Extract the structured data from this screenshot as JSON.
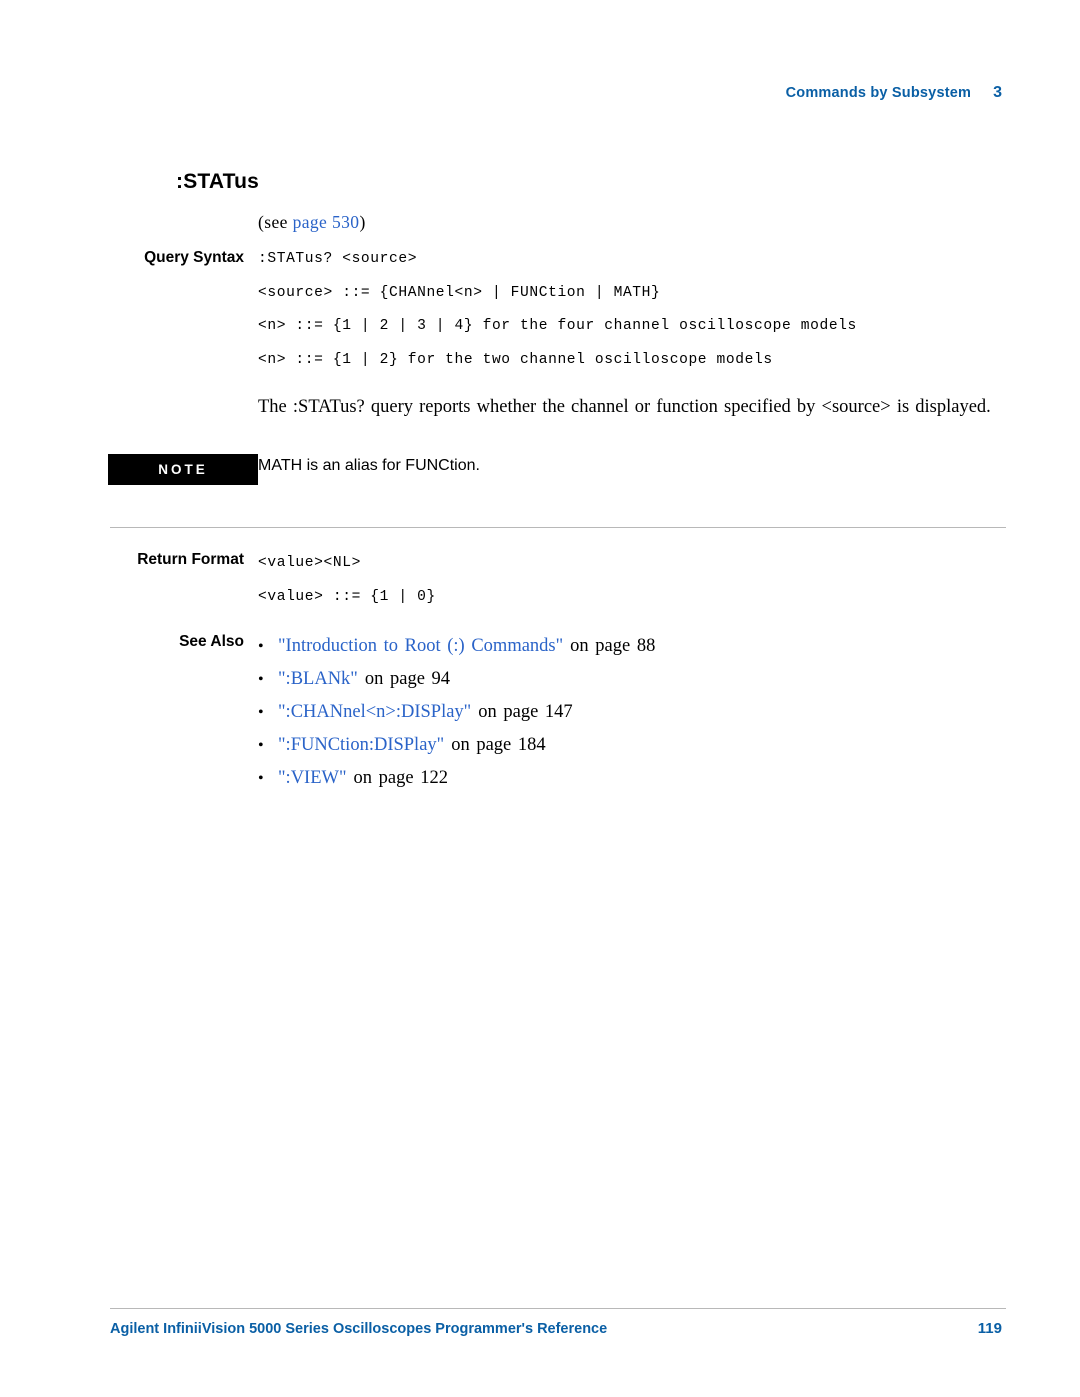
{
  "header": {
    "title": "Commands by Subsystem",
    "chapter": "3"
  },
  "command": {
    "title": ":STATus",
    "see_prefix": "(see ",
    "see_link": "page",
    "see_number": " 530",
    "see_suffix": ")"
  },
  "query_syntax": {
    "label": "Query Syntax",
    "lines": [
      ":STATus? <source>",
      "<source> ::= {CHANnel<n> | FUNCtion | MATH}",
      "<n> ::= {1 | 2 | 3 | 4} for the four channel oscilloscope models",
      "<n> ::= {1 | 2} for the two channel oscilloscope models"
    ]
  },
  "description": {
    "text": "The :STATus? query reports whether the channel or function specified by <source> is displayed."
  },
  "note": {
    "label": "NOTE",
    "text": "MATH is an alias for FUNCtion."
  },
  "return_format": {
    "label": "Return Format",
    "lines": [
      "<value><NL>",
      "<value> ::= {1 | 0}"
    ]
  },
  "see_also": {
    "label": "See Also",
    "items": [
      {
        "link": "\"Introduction to Root (:) Commands\"",
        "tail": "on page 88"
      },
      {
        "link": "\":BLANk\"",
        "tail": "on page 94"
      },
      {
        "link": "\":CHANnel<n>:DISPlay\"",
        "tail": "on page 147"
      },
      {
        "link": "\":FUNCtion:DISPlay\"",
        "tail": "on page 184"
      },
      {
        "link": "\":VIEW\"",
        "tail": "on page 122"
      }
    ]
  },
  "footer": {
    "left": "Agilent InfiniiVision 5000 Series Oscilloscopes Programmer's Reference",
    "right": "119"
  },
  "colors": {
    "accent": "#0a5fa5",
    "link": "#2a63c8"
  }
}
